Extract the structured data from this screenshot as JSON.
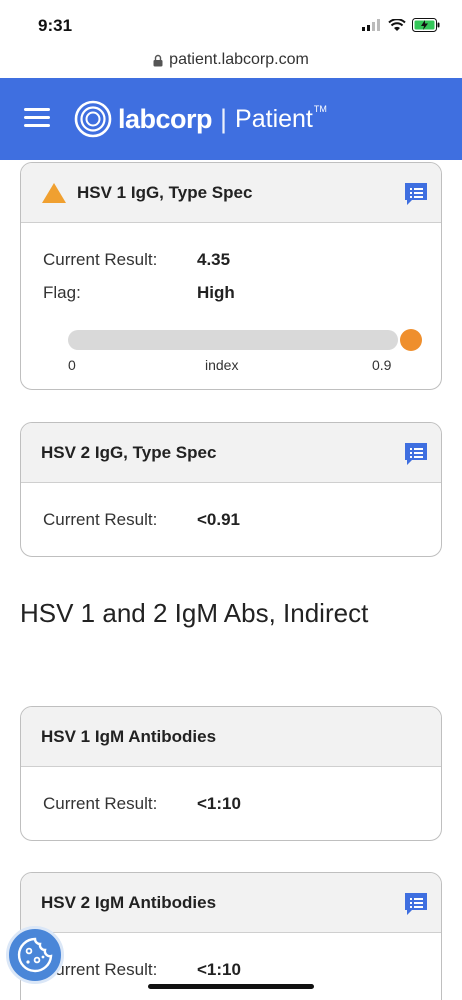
{
  "status_bar": {
    "time": "9:31"
  },
  "browser": {
    "url": "patient.labcorp.com"
  },
  "header": {
    "brand": "labcorp",
    "product": "Patient",
    "trademark": "TM"
  },
  "cards": [
    {
      "title": "HSV 1 IgG, Type Spec",
      "flagged": true,
      "current_result_label": "Current Result:",
      "current_result_value": "4.35",
      "flag_label": "Flag:",
      "flag_value": "High",
      "range": {
        "min_label": "0",
        "unit_label": "index",
        "max_label": "0.9",
        "min": 0,
        "max": 0.9,
        "value": 4.35
      }
    },
    {
      "title": "HSV 2 IgG, Type Spec",
      "current_result_label": "Current Result:",
      "current_result_value": "<0.91"
    }
  ],
  "section": {
    "title": "HSV 1 and 2 IgM Abs, Indirect"
  },
  "cards2": [
    {
      "title": "HSV 1 IgM Antibodies",
      "current_result_label": "Current Result:",
      "current_result_value": "<1:10"
    },
    {
      "title": "HSV 2 IgM Antibodies",
      "current_result_label": "Current Result:",
      "current_result_value": "<1:10"
    }
  ],
  "colors": {
    "header_bg": "#3f6fe0",
    "flag_warning": "#f0a030",
    "range_marker": "#ef8f2d",
    "comment_icon": "#3f6fe0"
  },
  "icons": [
    "hamburger-menu-icon",
    "labcorp-logo-icon",
    "warning-icon",
    "comment-icon",
    "cookie-icon",
    "lock-icon"
  ]
}
